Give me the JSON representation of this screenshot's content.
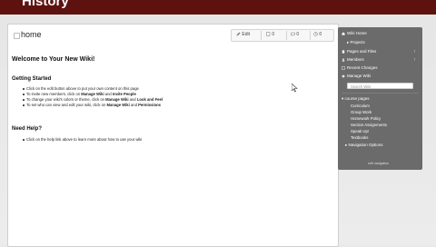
{
  "header": {
    "title": "History"
  },
  "page": {
    "title": "home"
  },
  "toolbar": {
    "edit": "Edit",
    "pages": "0",
    "comments": "0",
    "history": "0"
  },
  "main": {
    "welcome": "Welcome to Your New Wiki!",
    "getting_started": "Getting Started",
    "gs_items": [
      {
        "pre": "Click on the edit button above to put your own content on this page",
        "b1": "",
        "mid": "",
        "b2": ""
      },
      {
        "pre": "To invite new members, click on ",
        "b1": "Manage Wiki",
        "mid": " and ",
        "b2": "Invite People"
      },
      {
        "pre": "To change your wiki's colors or theme, click on ",
        "b1": "Manage Wiki",
        "mid": " and ",
        "b2": "Look and Feel"
      },
      {
        "pre": "To set who can view and edit your wiki, click on ",
        "b1": "Manage Wiki",
        "mid": " and ",
        "b2": "Permissions"
      }
    ],
    "need_help": "Need Help?",
    "help_items": [
      "Click on the help link above to learn more about how to use your wiki"
    ]
  },
  "sidebar": {
    "wiki_home": "Wiki Home",
    "projects": "Projects",
    "pages_files": "Pages and Files",
    "members": "Members",
    "recent_changes": "Recent Changes",
    "manage_wiki": "Manage Wiki",
    "search_placeholder": "Search Wiki",
    "nav_header": "course pages",
    "nav_items": [
      "Curriculum",
      "Group Work",
      "Homework Policy",
      "Section Assignments",
      "Speak Up!",
      "Textbooks"
    ],
    "navigation_options": "Navigation Options",
    "edit_navigation": "edit navigation"
  },
  "colors": {
    "header_bg": "#5e1210",
    "sidebar_bg": "#6b6b6b"
  }
}
